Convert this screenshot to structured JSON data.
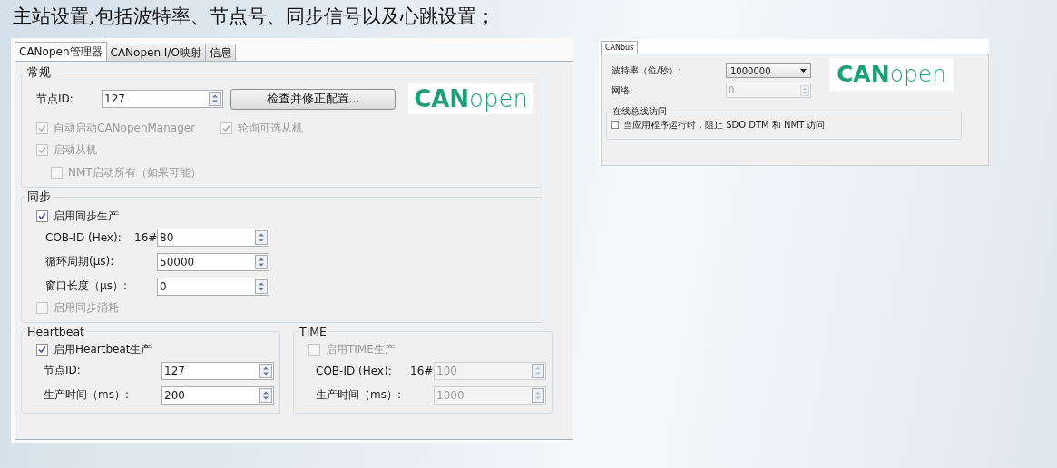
{
  "heading": "主站设置,包括波特率、节点号、同步信号以及心跳设置；",
  "main": {
    "tabs": [
      {
        "label": "CANopen管理器",
        "selected": true
      },
      {
        "label": "CANopen I/O映射",
        "selected": false
      },
      {
        "label": "信息",
        "selected": false
      }
    ],
    "general": {
      "title": "常规",
      "node_id": {
        "label": "节点ID:",
        "value": "127"
      },
      "check_button": "检查并修正配置...",
      "logo": "**CAN**open",
      "option_rows": [
        [
          {
            "label": "自动启动CANopenManager",
            "checked": true,
            "disabled": true
          },
          {
            "label": "轮询可选从机",
            "checked": true,
            "disabled": true
          }
        ],
        [
          {
            "label": "启动从机",
            "checked": true,
            "disabled": true,
            "children": [
              {
                "label": "NMT启动所有（如果可能）",
                "checked": false,
                "disabled": true
              }
            ]
          }
        ]
      ]
    },
    "sync": {
      "title": "同步",
      "enable": {
        "label": "启用同步生产",
        "checked": true,
        "disabled": false
      },
      "fields": [
        {
          "label": "COB-ID (Hex):",
          "prefix": "16#",
          "value": "80",
          "disabled": false
        },
        {
          "label": "循环周期(µs):",
          "value": "50000",
          "disabled": false
        },
        {
          "label": "窗口长度（µs）:",
          "value": "0",
          "disabled": false
        }
      ],
      "consume": {
        "label": "启用同步消耗",
        "checked": false,
        "disabled": true
      }
    },
    "heartbeat": {
      "title": "Heartbeat",
      "enable": {
        "label": "启用Heartbeat生产",
        "checked": true,
        "disabled": false
      },
      "fields": [
        {
          "label": "节点ID:",
          "value": "127",
          "disabled": false
        },
        {
          "label": "生产时间（ms）:",
          "value": "200",
          "disabled": false
        }
      ]
    },
    "time": {
      "title": "TIME",
      "enable": {
        "label": "启用TIME生产",
        "checked": false,
        "disabled": true
      },
      "fields": [
        {
          "label": "COB-ID (Hex):",
          "prefix": "16#",
          "value": "100",
          "disabled": true
        },
        {
          "label": "生产时间（ms）:",
          "value": "1000",
          "disabled": true
        }
      ]
    }
  },
  "canbus": {
    "tabs": [
      {
        "label": "CANbus",
        "selected": true
      }
    ],
    "baud": {
      "label": "波特率（位/秒）:",
      "value": "1000000"
    },
    "network": {
      "label": "网络:",
      "value": "0",
      "disabled": true
    },
    "logo": "**CAN**open",
    "online": {
      "title": "在线总线访问",
      "option": {
        "label": "当应用程序运行时，阻止 SDO DTM 和 NMT 访问",
        "checked": false,
        "disabled": false
      }
    }
  }
}
